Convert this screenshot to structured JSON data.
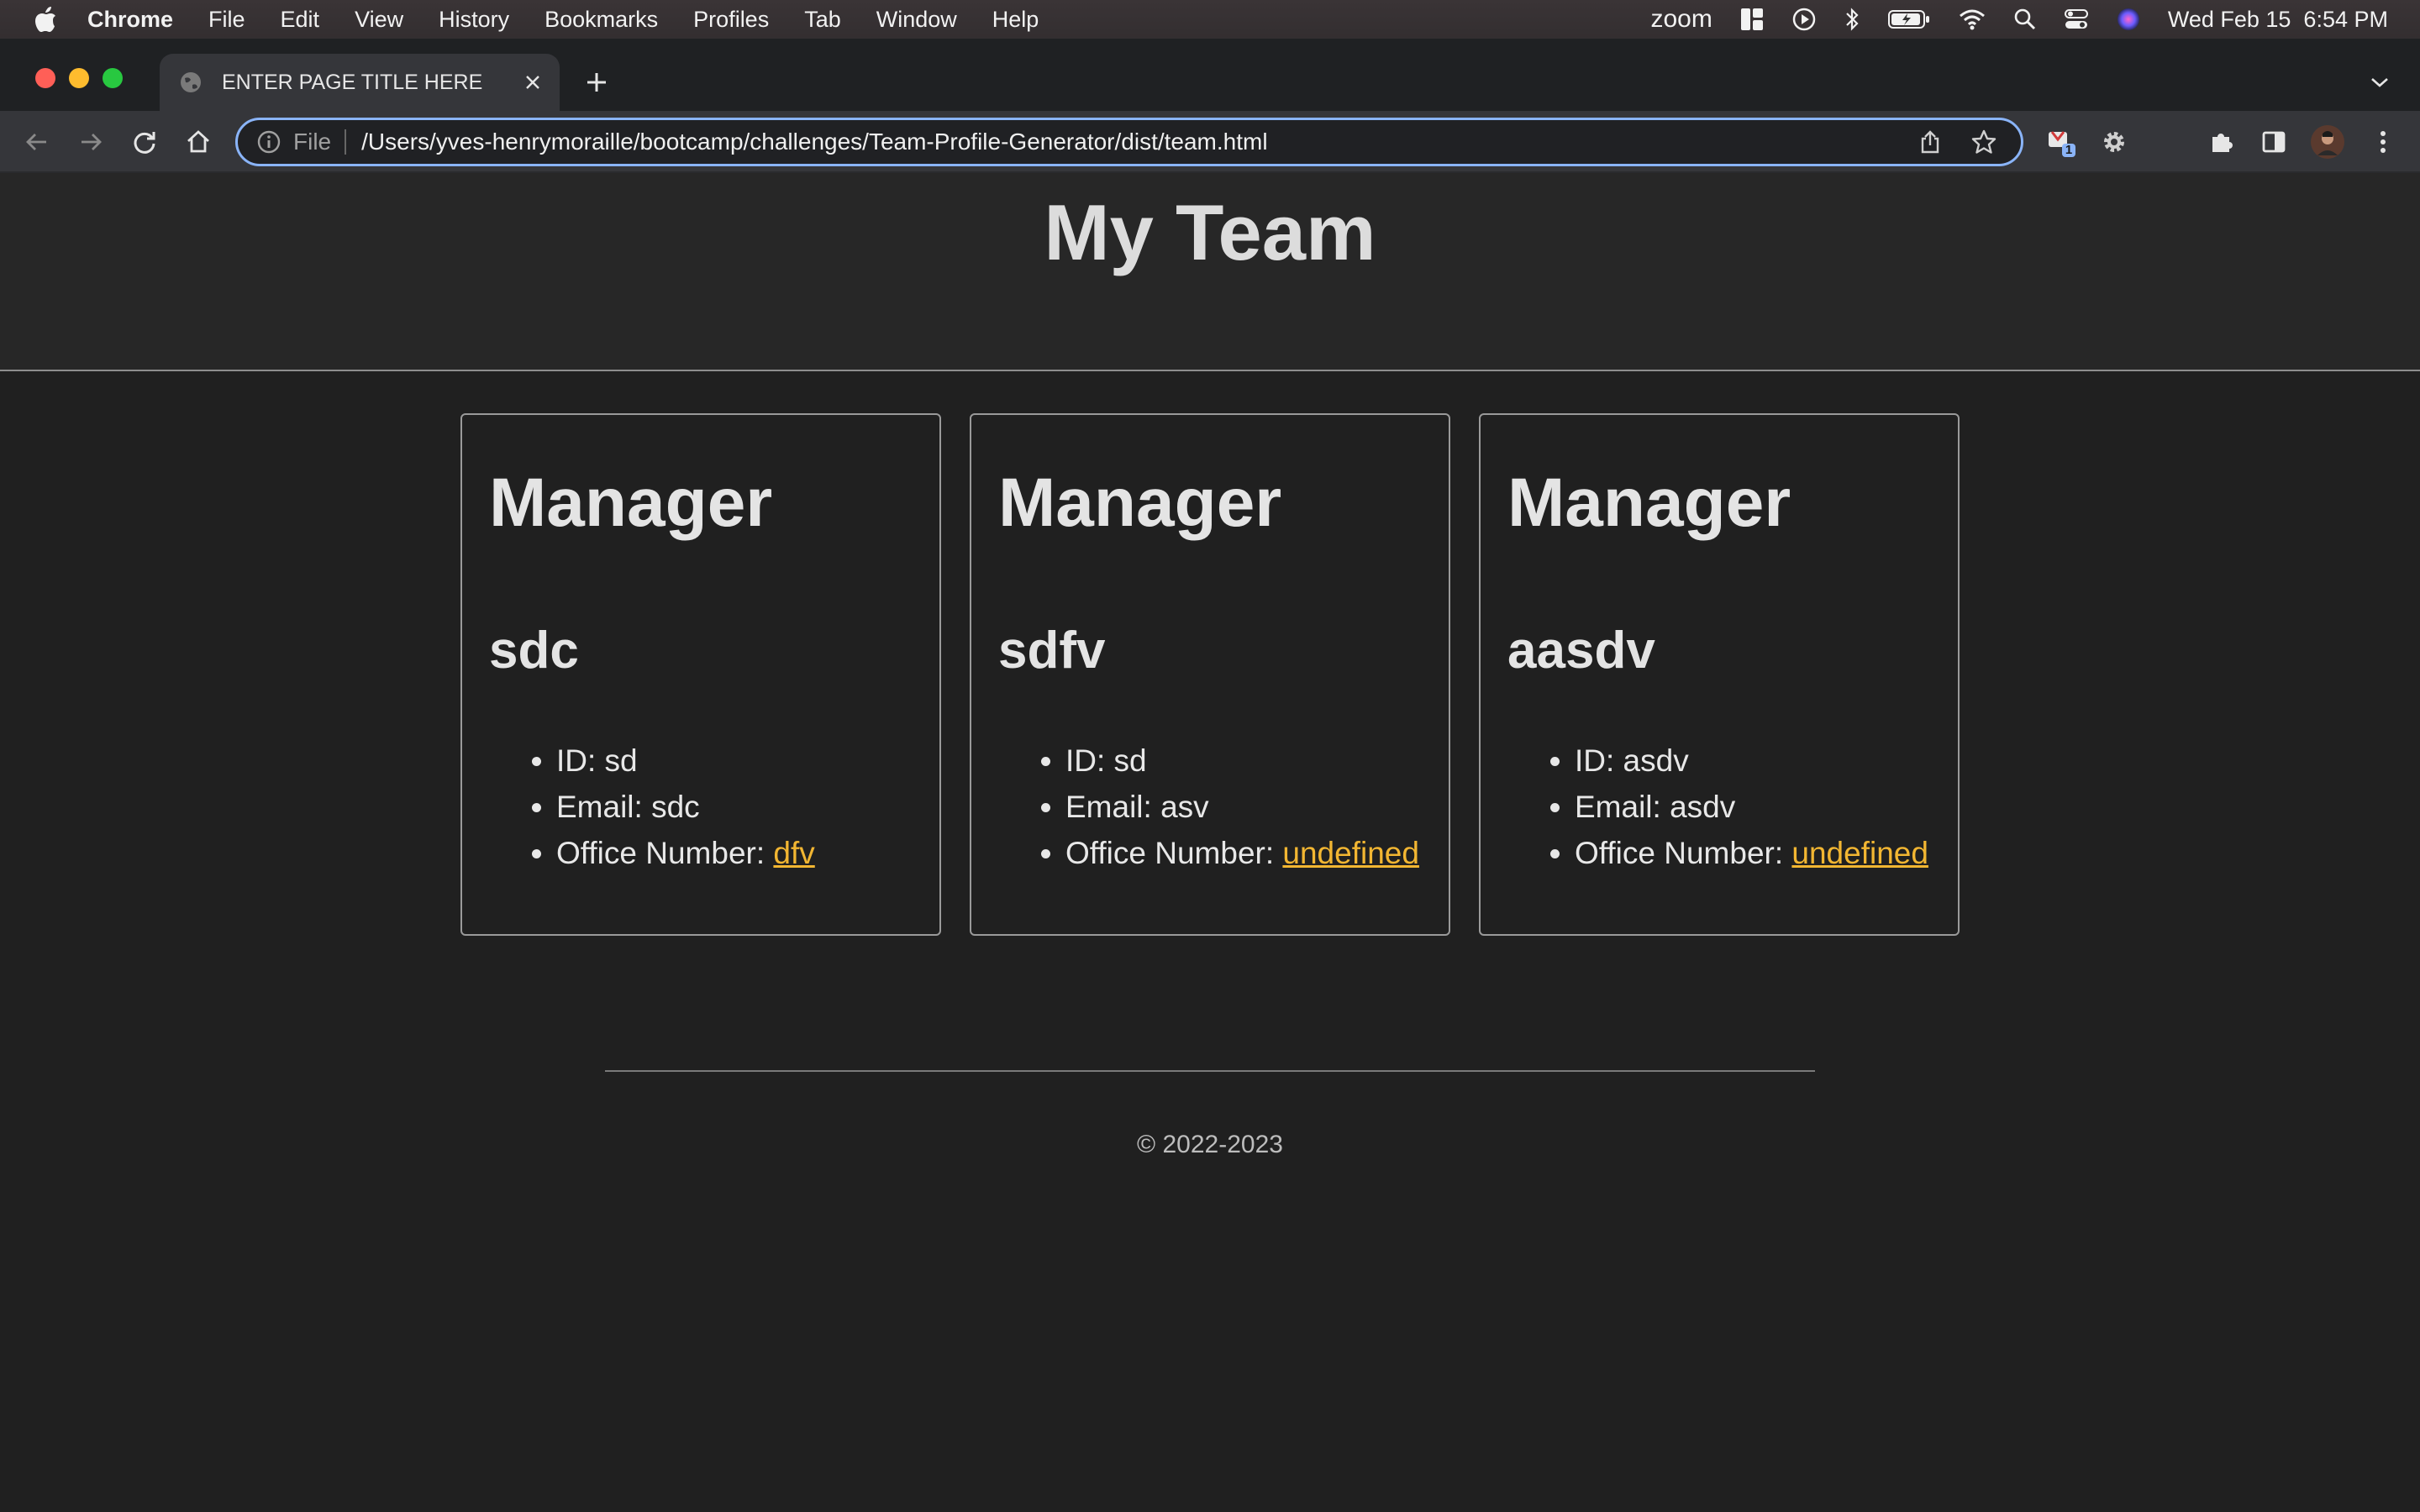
{
  "menubar": {
    "app_name": "Chrome",
    "items": [
      "File",
      "Edit",
      "View",
      "History",
      "Bookmarks",
      "Profiles",
      "Tab",
      "Window",
      "Help"
    ],
    "zoom_label": "zoom",
    "datetime": "Wed Feb 15  6:54 PM"
  },
  "tab": {
    "title": "ENTER PAGE TITLE HERE"
  },
  "toolbar": {
    "scheme_label": "File",
    "url": "/Users/yves-henrymoraille/bootcamp/challenges/Team-Profile-Generator/dist/team.html",
    "extension_badge": "1"
  },
  "page": {
    "title": "My Team",
    "cards": [
      {
        "role": "Manager",
        "name": "sdc",
        "id_label": "ID: sd",
        "email_label": "Email: sdc",
        "office_prefix": "Office Number: ",
        "office_value": "dfv"
      },
      {
        "role": "Manager",
        "name": "sdfv",
        "id_label": "ID: sd",
        "email_label": "Email: asv",
        "office_prefix": "Office Number: ",
        "office_value": "undefined"
      },
      {
        "role": "Manager",
        "name": "aasdv",
        "id_label": "ID: asdv",
        "email_label": "Email: asdv",
        "office_prefix": "Office Number: ",
        "office_value": "undefined"
      }
    ],
    "footer": "© 2022-2023"
  },
  "colors": {
    "link": "#f2b632",
    "accent_focus": "#8ab4f8",
    "background": "#202020"
  },
  "icons": [
    "apple-icon",
    "zoom-icon",
    "sidebar-layout-icon",
    "play-circle-icon",
    "bluetooth-icon",
    "battery-icon",
    "wifi-icon",
    "spotlight-search-icon",
    "control-center-icon",
    "siri-icon",
    "globe-icon",
    "close-icon",
    "plus-icon",
    "chevron-down-icon",
    "back-arrow-icon",
    "forward-arrow-icon",
    "reload-icon",
    "home-icon",
    "info-icon",
    "share-icon",
    "star-icon",
    "extension-icon",
    "gear-icon",
    "puzzle-icon",
    "side-panel-icon",
    "avatar",
    "kebab-menu-icon"
  ]
}
